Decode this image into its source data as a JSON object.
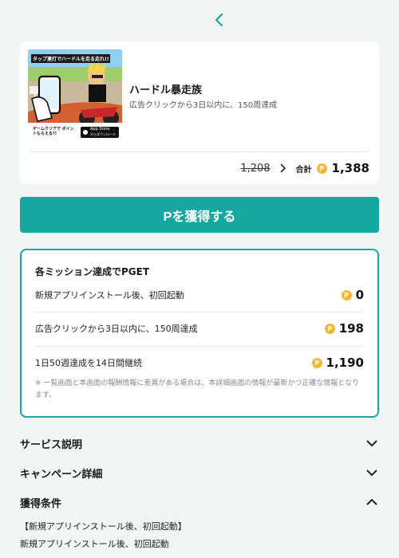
{
  "app": {
    "name": "ハードル暴走族",
    "description": "広告クリックから3日以内に、150周達成",
    "banner": {
      "top_text": "タップ連打でハードルを走る走れ!!",
      "bottom_text": "ゲームクリアで ポイントもらえる?!",
      "store_label": "App Store",
      "store_sub": "からダウンロード"
    }
  },
  "price": {
    "old": "1,208",
    "total_label": "合計",
    "new": "1,388",
    "coin_symbol": "P"
  },
  "cta": {
    "label": "Pを獲得する"
  },
  "missions": {
    "title": "各ミッション達成でPGET",
    "rows": [
      {
        "label": "新規アプリインストール後、初回起動",
        "points": "0"
      },
      {
        "label": "広告クリックから3日以内に、150周達成",
        "points": "198"
      },
      {
        "label": "1日50週達成を14日間継続",
        "points": "1,190"
      }
    ],
    "note": "※ 一覧画面と本画面の報酬情報に差異がある場合は、本詳細画面の情報が最新かつ正確な情報となります。"
  },
  "sections": {
    "service": "サービス説明",
    "campaign": "キャンペーン詳細",
    "conditions": "獲得条件"
  },
  "conditions": {
    "heading": "【新規アプリインストール後、初回起動】",
    "text": "新規アプリインストール後、初回起動"
  },
  "colors": {
    "accent": "#15a8a0",
    "coin": "#f3b731",
    "background": "#f3f4f4"
  }
}
